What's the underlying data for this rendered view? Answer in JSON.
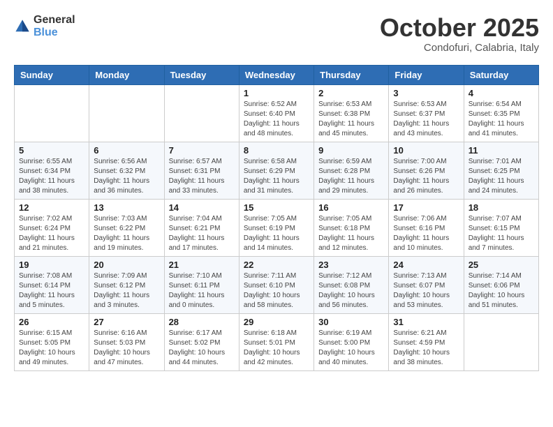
{
  "header": {
    "logo_general": "General",
    "logo_blue": "Blue",
    "month": "October 2025",
    "location": "Condofuri, Calabria, Italy"
  },
  "weekdays": [
    "Sunday",
    "Monday",
    "Tuesday",
    "Wednesday",
    "Thursday",
    "Friday",
    "Saturday"
  ],
  "weeks": [
    [
      {
        "day": "",
        "info": ""
      },
      {
        "day": "",
        "info": ""
      },
      {
        "day": "",
        "info": ""
      },
      {
        "day": "1",
        "info": "Sunrise: 6:52 AM\nSunset: 6:40 PM\nDaylight: 11 hours\nand 48 minutes."
      },
      {
        "day": "2",
        "info": "Sunrise: 6:53 AM\nSunset: 6:38 PM\nDaylight: 11 hours\nand 45 minutes."
      },
      {
        "day": "3",
        "info": "Sunrise: 6:53 AM\nSunset: 6:37 PM\nDaylight: 11 hours\nand 43 minutes."
      },
      {
        "day": "4",
        "info": "Sunrise: 6:54 AM\nSunset: 6:35 PM\nDaylight: 11 hours\nand 41 minutes."
      }
    ],
    [
      {
        "day": "5",
        "info": "Sunrise: 6:55 AM\nSunset: 6:34 PM\nDaylight: 11 hours\nand 38 minutes."
      },
      {
        "day": "6",
        "info": "Sunrise: 6:56 AM\nSunset: 6:32 PM\nDaylight: 11 hours\nand 36 minutes."
      },
      {
        "day": "7",
        "info": "Sunrise: 6:57 AM\nSunset: 6:31 PM\nDaylight: 11 hours\nand 33 minutes."
      },
      {
        "day": "8",
        "info": "Sunrise: 6:58 AM\nSunset: 6:29 PM\nDaylight: 11 hours\nand 31 minutes."
      },
      {
        "day": "9",
        "info": "Sunrise: 6:59 AM\nSunset: 6:28 PM\nDaylight: 11 hours\nand 29 minutes."
      },
      {
        "day": "10",
        "info": "Sunrise: 7:00 AM\nSunset: 6:26 PM\nDaylight: 11 hours\nand 26 minutes."
      },
      {
        "day": "11",
        "info": "Sunrise: 7:01 AM\nSunset: 6:25 PM\nDaylight: 11 hours\nand 24 minutes."
      }
    ],
    [
      {
        "day": "12",
        "info": "Sunrise: 7:02 AM\nSunset: 6:24 PM\nDaylight: 11 hours\nand 21 minutes."
      },
      {
        "day": "13",
        "info": "Sunrise: 7:03 AM\nSunset: 6:22 PM\nDaylight: 11 hours\nand 19 minutes."
      },
      {
        "day": "14",
        "info": "Sunrise: 7:04 AM\nSunset: 6:21 PM\nDaylight: 11 hours\nand 17 minutes."
      },
      {
        "day": "15",
        "info": "Sunrise: 7:05 AM\nSunset: 6:19 PM\nDaylight: 11 hours\nand 14 minutes."
      },
      {
        "day": "16",
        "info": "Sunrise: 7:05 AM\nSunset: 6:18 PM\nDaylight: 11 hours\nand 12 minutes."
      },
      {
        "day": "17",
        "info": "Sunrise: 7:06 AM\nSunset: 6:16 PM\nDaylight: 11 hours\nand 10 minutes."
      },
      {
        "day": "18",
        "info": "Sunrise: 7:07 AM\nSunset: 6:15 PM\nDaylight: 11 hours\nand 7 minutes."
      }
    ],
    [
      {
        "day": "19",
        "info": "Sunrise: 7:08 AM\nSunset: 6:14 PM\nDaylight: 11 hours\nand 5 minutes."
      },
      {
        "day": "20",
        "info": "Sunrise: 7:09 AM\nSunset: 6:12 PM\nDaylight: 11 hours\nand 3 minutes."
      },
      {
        "day": "21",
        "info": "Sunrise: 7:10 AM\nSunset: 6:11 PM\nDaylight: 11 hours\nand 0 minutes."
      },
      {
        "day": "22",
        "info": "Sunrise: 7:11 AM\nSunset: 6:10 PM\nDaylight: 10 hours\nand 58 minutes."
      },
      {
        "day": "23",
        "info": "Sunrise: 7:12 AM\nSunset: 6:08 PM\nDaylight: 10 hours\nand 56 minutes."
      },
      {
        "day": "24",
        "info": "Sunrise: 7:13 AM\nSunset: 6:07 PM\nDaylight: 10 hours\nand 53 minutes."
      },
      {
        "day": "25",
        "info": "Sunrise: 7:14 AM\nSunset: 6:06 PM\nDaylight: 10 hours\nand 51 minutes."
      }
    ],
    [
      {
        "day": "26",
        "info": "Sunrise: 6:15 AM\nSunset: 5:05 PM\nDaylight: 10 hours\nand 49 minutes."
      },
      {
        "day": "27",
        "info": "Sunrise: 6:16 AM\nSunset: 5:03 PM\nDaylight: 10 hours\nand 47 minutes."
      },
      {
        "day": "28",
        "info": "Sunrise: 6:17 AM\nSunset: 5:02 PM\nDaylight: 10 hours\nand 44 minutes."
      },
      {
        "day": "29",
        "info": "Sunrise: 6:18 AM\nSunset: 5:01 PM\nDaylight: 10 hours\nand 42 minutes."
      },
      {
        "day": "30",
        "info": "Sunrise: 6:19 AM\nSunset: 5:00 PM\nDaylight: 10 hours\nand 40 minutes."
      },
      {
        "day": "31",
        "info": "Sunrise: 6:21 AM\nSunset: 4:59 PM\nDaylight: 10 hours\nand 38 minutes."
      },
      {
        "day": "",
        "info": ""
      }
    ]
  ]
}
